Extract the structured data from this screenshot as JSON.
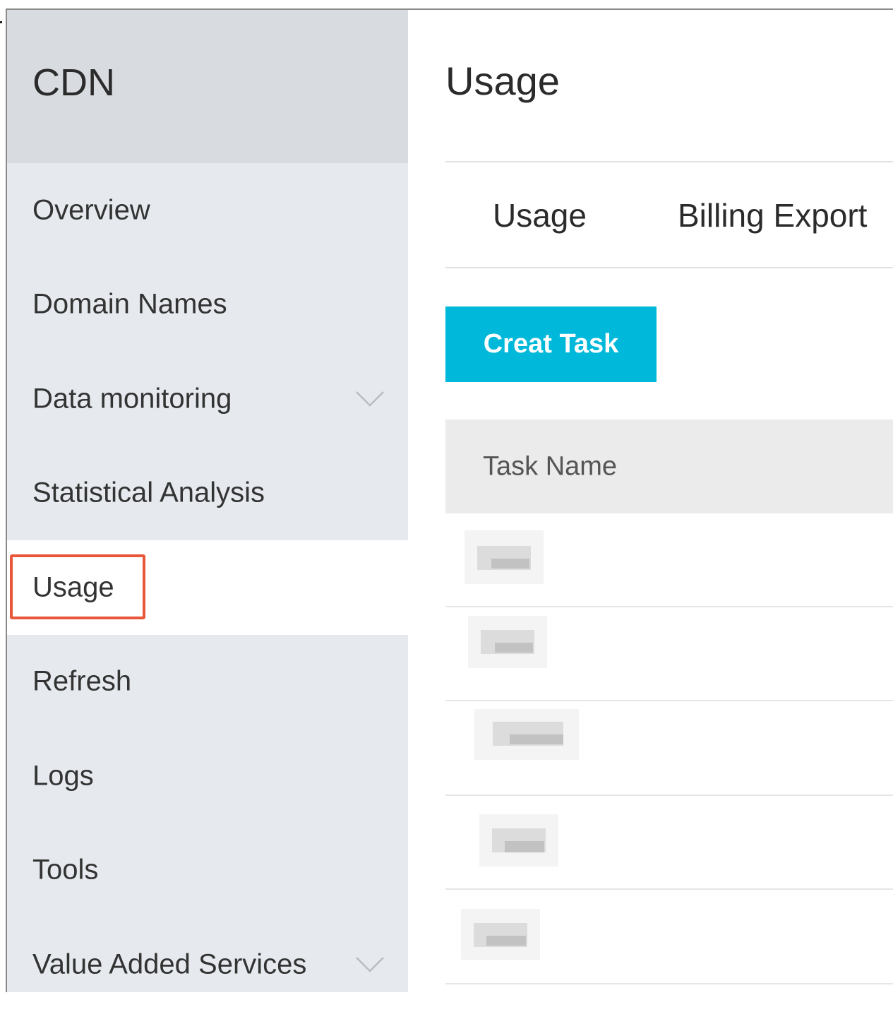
{
  "sidebar": {
    "title": "CDN",
    "items": [
      {
        "label": "Overview"
      },
      {
        "label": "Domain Names"
      },
      {
        "label": "Data monitoring"
      },
      {
        "label": "Statistical Analysis"
      },
      {
        "label": "Usage"
      },
      {
        "label": "Refresh"
      },
      {
        "label": "Logs"
      },
      {
        "label": "Tools"
      },
      {
        "label": "Value Added Services"
      }
    ]
  },
  "main": {
    "title": "Usage",
    "tabs": [
      {
        "label": "Usage"
      },
      {
        "label": "Billing Export"
      }
    ],
    "create_button": "Creat Task",
    "table": {
      "column_header": "Task Name"
    }
  },
  "colors": {
    "accent": "#00b8d9",
    "highlight": "#e8573a",
    "sidebar_bg": "#e6eaee"
  }
}
